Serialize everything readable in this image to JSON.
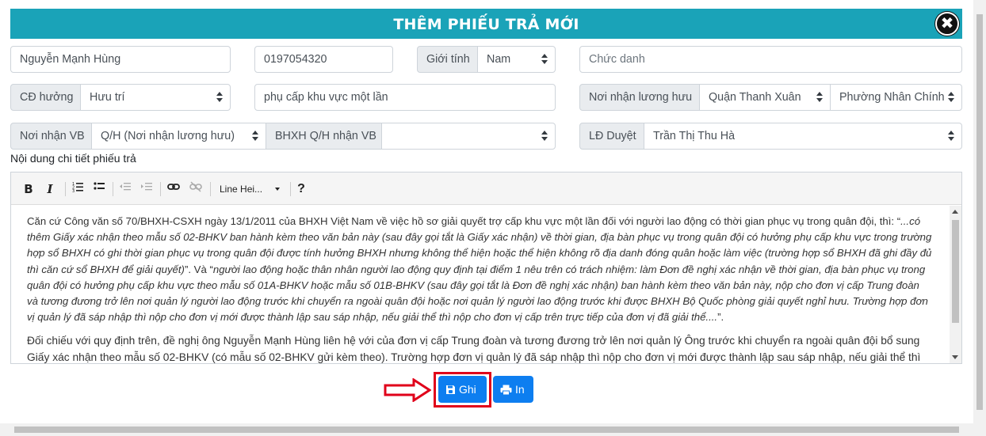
{
  "modal": {
    "title": "THÊM PHIẾU TRẢ MỚI",
    "close_label": "✖"
  },
  "row1": {
    "name_value": "Nguyễn Mạnh Hùng",
    "phone_value": "0197054320",
    "gender_label": "Giới tính",
    "gender_value": "Nam",
    "title_placeholder": "Chức danh"
  },
  "row2": {
    "benefit_label": "CĐ hưởng",
    "benefit_value": "Hưu trí",
    "reason_value": "phụ cấp khu vực một lần",
    "pension_place_label": "Nơi nhận lương hưu",
    "district_value": "Quận Thanh Xuân",
    "ward_value": "Phường Nhân Chính"
  },
  "row3": {
    "doc_place_label": "Nơi nhận VB",
    "doc_place_value": "Q/H (Nơi nhận lương hưu)",
    "bhxh_label": "BHXH Q/H nhận VB",
    "bhxh_value": "",
    "approver_label": "LĐ Duyệt",
    "approver_value": "Trần Thị Thu Hà"
  },
  "editor": {
    "section_label": "Nội dung chi tiết phiếu trả",
    "toolbar": {
      "bold": "B",
      "italic": "I",
      "line_height": "Line Hei...",
      "help": "?"
    },
    "paragraph1_normal": "Căn cứ Công văn số 70/BHXH-CSXH ngày 13/1/2011 của BHXH Việt Nam về việc hồ sơ giải quyết trợ cấp khu vực một lần đối với người lao động có thời gian phục vụ trong quân đội, thì: “",
    "paragraph1_italic": "...có thêm Giấy xác nhận theo mẫu số 02-BHKV ban hành kèm theo văn bản này (sau đây gọi tắt là Giấy xác nhận) về thời gian, địa bàn phục vụ trong quân đội có hưởng phụ cấp khu vực trong trường hợp sổ BHXH có ghi thời gian phục vụ trong quân đội được tính hưởng BHXH nhưng không thể hiện hoặc thể hiện không rõ địa danh đóng quân hoặc làm việc (trường hợp sổ BHXH đã ghi đầy đủ thì căn cứ sổ BHXH để giải quyết)",
    "paragraph1_mid": "”. Và “",
    "paragraph1_italic2": "người lao động hoặc thân nhân người lao động quy định tại điểm 1 nêu trên có trách nhiệm: làm Đơn đề nghị xác nhận về thời gian, địa bàn phục vụ trong quân đội có hưởng phụ cấp khu vực theo mẫu số 01A-BHKV hoặc mẫu số 01B-BHKV (sau đây gọi tắt là Đơn đề nghị xác nhận) ban hành kèm theo văn bản này, nộp cho đơn vị cấp Trung đoàn và tương đương trở lên nơi quản lý người lao động trước khi chuyển ra ngoài quân đội hoặc nơi quản lý người lao động trước khi được BHXH Bộ Quốc phòng giải quyết nghỉ hưu. Trường hợp đơn vị quản lý đã sáp nhập thì nộp cho đơn vị mới được thành lập sau sáp nhập, nếu giải thể thì nộp cho đơn vị cấp trên trực tiếp của đơn vị đã giải thể....",
    "paragraph1_end": "”.",
    "paragraph2": "Đối chiếu với quy định trên, đề nghị ông Nguyễn Mạnh Hùng liên hệ với của đơn vị cấp Trung đoàn và tương đương trở lên nơi quản lý Ông trước khi chuyển ra ngoài quân đội bổ sung Giấy xác nhận theo mẫu số 02-BHKV (có mẫu số 02-BHKV gửi kèm theo). Trường hợp đơn vị quản lý đã sáp nhập thì nộp cho đơn vị mới được thành lập sau sáp nhập, nếu giải thể thì nộp cho đơn vị cấp trên"
  },
  "actions": {
    "save_label": "Ghi",
    "print_label": "In"
  },
  "colors": {
    "header": "#1aa3b8",
    "primary_button": "#0d7ef0",
    "highlight": "#e0001a"
  },
  "icons": {
    "close": "close-icon",
    "save": "floppy-disk-icon",
    "print": "printer-icon",
    "arrow": "arrow-right-icon"
  }
}
